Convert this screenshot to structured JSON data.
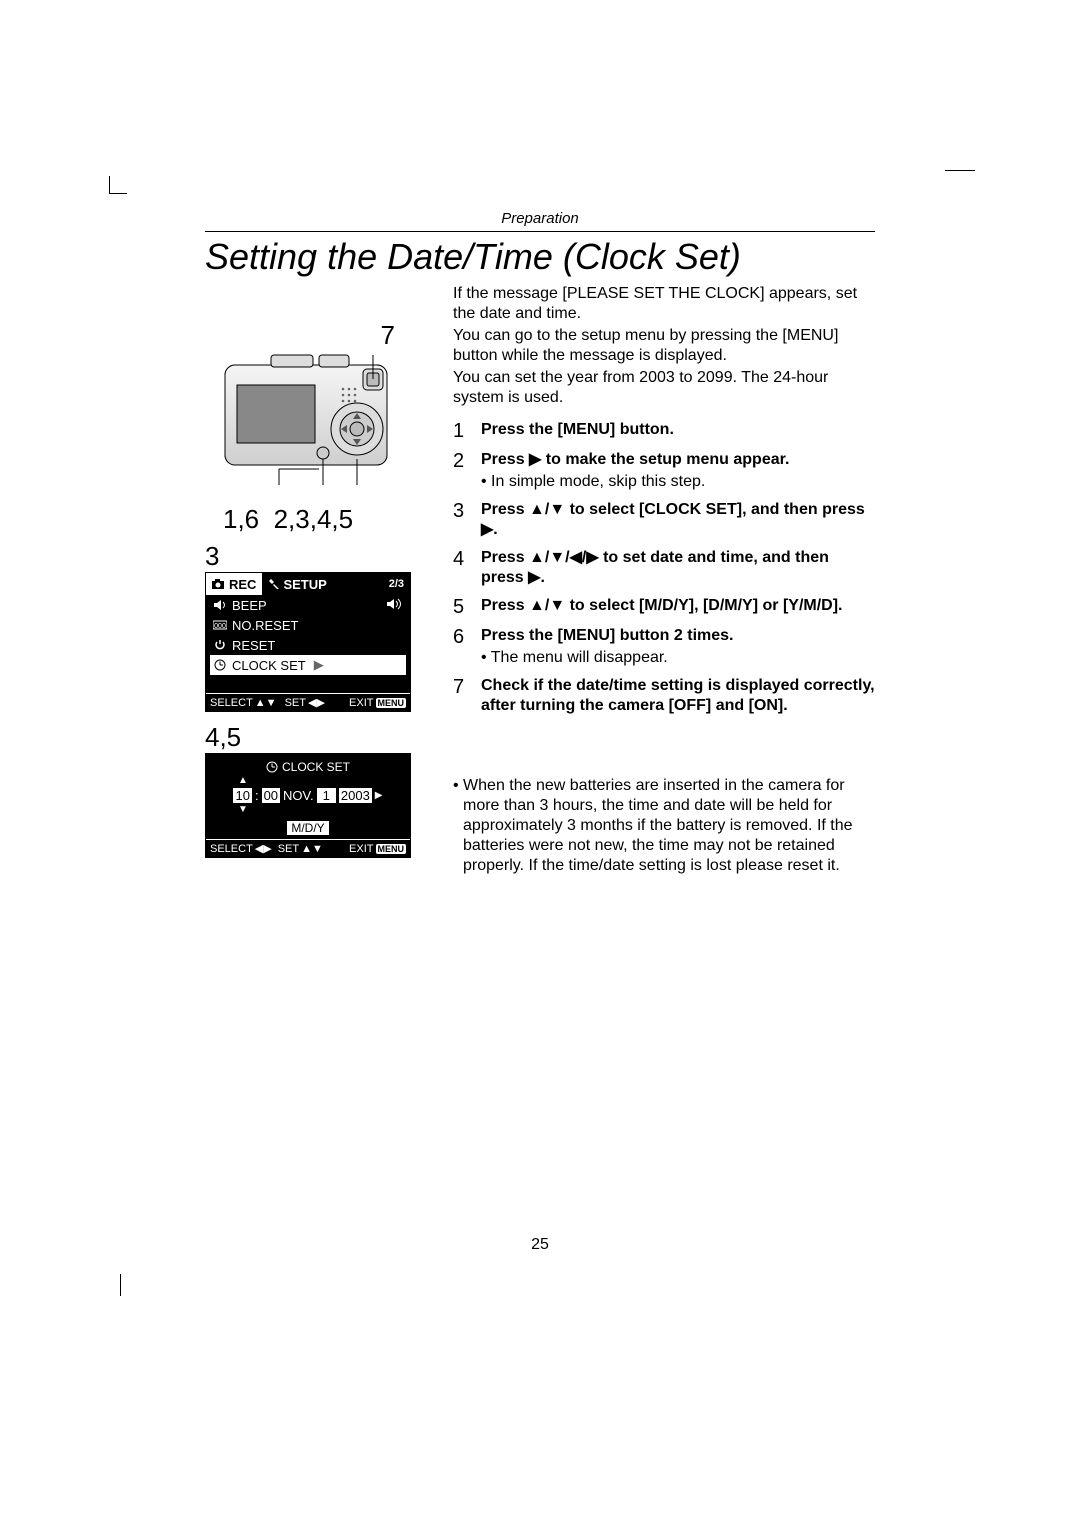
{
  "header": {
    "section": "Preparation"
  },
  "title": "Setting the Date/Time (Clock Set)",
  "callouts": {
    "top": "7",
    "row": "1,6  2,3,4,5",
    "three": "3",
    "fourfive": "4,5"
  },
  "lcd_setup": {
    "tab_rec": "REC",
    "tab_setup": "SETUP",
    "tab_page": "2/3",
    "rows": [
      {
        "icon": "speaker-icon",
        "label": "BEEP",
        "value_icon": "sound-on-icon"
      },
      {
        "icon": "counter-icon",
        "label": "NO.RESET"
      },
      {
        "icon": "reset-icon",
        "label": "RESET"
      },
      {
        "icon": "clock-icon",
        "label": "CLOCK SET",
        "hl": true,
        "arrow": true
      }
    ],
    "bottom": {
      "select": "SELECT",
      "set": "SET",
      "exit": "EXIT",
      "menu": "MENU"
    }
  },
  "lcd_clock": {
    "title": "CLOCK SET",
    "time_h": "10",
    "time_m": "00",
    "month": "NOV.",
    "day": "1",
    "year": "2003",
    "format": "M/D/Y",
    "bottom": {
      "select": "SELECT",
      "set": "SET",
      "exit": "EXIT",
      "menu": "MENU"
    }
  },
  "intro": {
    "p1": "If the message [PLEASE SET THE CLOCK] appears, set the date and time.",
    "p2": "You can go to the setup menu by pressing the [MENU] button while the message is displayed.",
    "p3": "You can set the year from 2003 to 2099. The 24-hour system is used."
  },
  "steps": [
    {
      "n": "1",
      "body": "Press the [MENU] button."
    },
    {
      "n": "2",
      "body": "Press ▶ to make the setup menu appear.",
      "sub": "In simple mode, skip this step."
    },
    {
      "n": "3",
      "body": "Press ▲/▼ to select [CLOCK SET], and then press ▶."
    },
    {
      "n": "4",
      "body": "Press ▲/▼/◀/▶ to set date and time, and then press ▶."
    },
    {
      "n": "5",
      "body": "Press ▲/▼ to select [M/D/Y], [D/M/Y] or [Y/M/D]."
    },
    {
      "n": "6",
      "body": "Press the [MENU] button 2 times.",
      "sub": "The menu will disappear."
    },
    {
      "n": "7",
      "body": "Check if the date/time setting is displayed correctly, after turning the camera [OFF] and [ON]."
    }
  ],
  "note": "When the new batteries are inserted in the camera for more than 3 hours, the time and date will be held for approximately 3 months if the battery is removed. If the batteries were not new, the time may not be retained properly. If the time/date setting is lost please reset it.",
  "page_number": "25"
}
